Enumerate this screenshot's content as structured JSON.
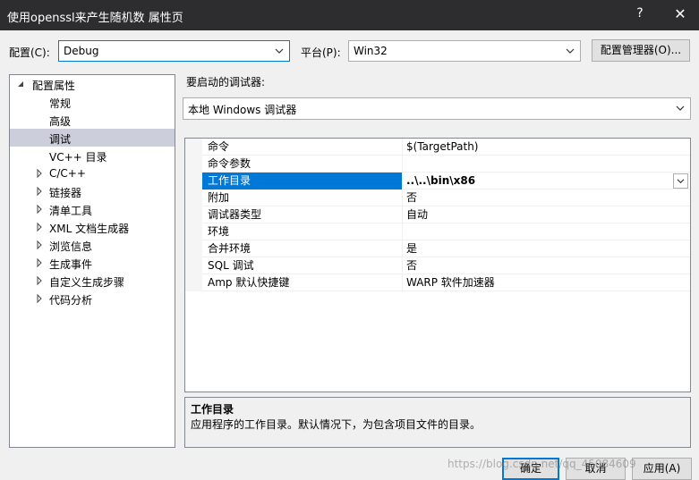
{
  "window": {
    "title": "使用openssl来产生随机数 属性页",
    "help_glyph": "?",
    "close_glyph": "✕"
  },
  "config": {
    "label": "配置(C):",
    "value": "Debug"
  },
  "platform": {
    "label": "平台(P):",
    "value": "Win32"
  },
  "config_manager_label": "配置管理器(O)...",
  "tree": {
    "root": "配置属性",
    "items": [
      "常规",
      "高级",
      "调试",
      "VC++ 目录",
      "C/C++",
      "链接器",
      "清单工具",
      "XML 文档生成器",
      "浏览信息",
      "生成事件",
      "自定义生成步骤",
      "代码分析"
    ]
  },
  "debugger": {
    "label": "要启动的调试器:",
    "value": "本地 Windows 调试器"
  },
  "properties": [
    {
      "name": "命令",
      "value": "$(TargetPath)"
    },
    {
      "name": "命令参数",
      "value": ""
    },
    {
      "name": "工作目录",
      "value": "..\\..\\bin\\x86"
    },
    {
      "name": "附加",
      "value": "否"
    },
    {
      "name": "调试器类型",
      "value": "自动"
    },
    {
      "name": "环境",
      "value": ""
    },
    {
      "name": "合并环境",
      "value": "是"
    },
    {
      "name": "SQL 调试",
      "value": "否"
    },
    {
      "name": "Amp 默认快捷键",
      "value": "WARP 软件加速器"
    }
  ],
  "description": {
    "title": "工作目录",
    "text": "应用程序的工作目录。默认情况下，为包含项目文件的目录。"
  },
  "buttons": {
    "ok": "确定",
    "cancel": "取消",
    "apply": "应用(A)"
  },
  "watermark": "https://blog.csdn.net/qq_45084609"
}
